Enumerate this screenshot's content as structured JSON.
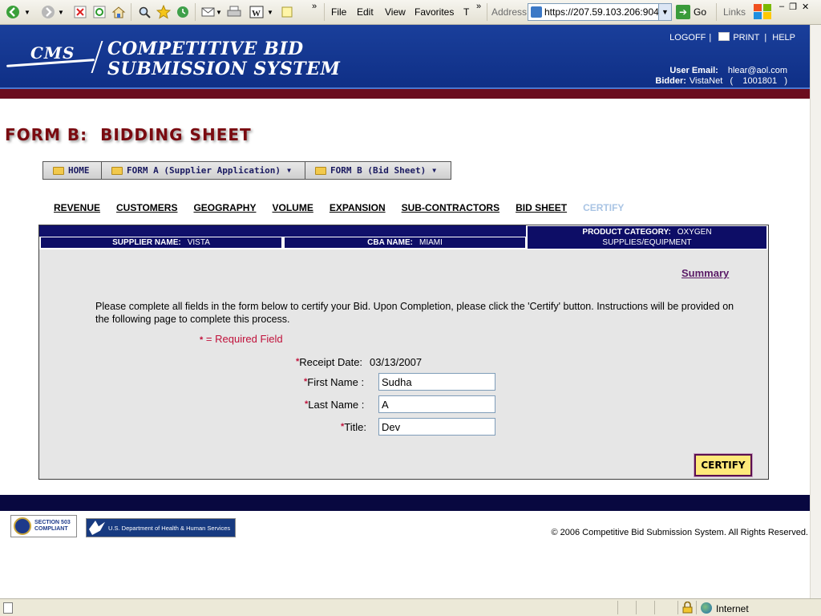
{
  "browser": {
    "menu": [
      "File",
      "Edit",
      "View",
      "Favorites",
      "T"
    ],
    "address_label": "Address",
    "address_url": "https://207.59.103.206:9049",
    "go_label": "Go",
    "links_label": "Links",
    "chevron": "»",
    "status_zone": "Internet"
  },
  "header": {
    "logo_text": "CMS",
    "title_line1": "COMPETITIVE BID",
    "title_line2": "SUBMISSION SYSTEM",
    "logoff": "LOGOFF",
    "print": "PRINT",
    "help": "HELP",
    "sep": "|",
    "user_email_label": "User Email:",
    "user_email": "hlear@aol.com",
    "bidder_label": "Bidder:",
    "bidder_value": "VistaNet   (    1001801   )"
  },
  "page": {
    "form_title": "FORM B:  BIDDING SHEET"
  },
  "nav": {
    "home": "HOME",
    "form_a": "FORM A (Supplier Application)",
    "form_b": "FORM B (Bid Sheet)"
  },
  "sub_tabs": {
    "revenue": "REVENUE",
    "customers": "CUSTOMERS",
    "geography": "GEOGRAPHY",
    "volume": "VOLUME",
    "expansion": "EXPANSION",
    "subcontractors": "SUB-CONTRACTORS",
    "bid_sheet": "BID SHEET",
    "certify": "CERTIFY"
  },
  "info": {
    "supplier_label": "SUPPLIER NAME:",
    "supplier_value": "VISTA",
    "cba_label": "CBA NAME:",
    "cba_value": "MIAMI",
    "category_label": "PRODUCT CATEGORY:",
    "category_value_1": "OXYGEN",
    "category_value_2": "SUPPLIES/EQUIPMENT"
  },
  "certify_form": {
    "summary_link": "Summary",
    "instructions": "Please complete all fields in the form below to certify your Bid. Upon Completion, please click the 'Certify' button. Instructions will be provided on the following page to complete this process.",
    "star": "*",
    "required_note": "= Required Field",
    "receipt_label": "Receipt Date:",
    "receipt_value": "03/13/2007",
    "first_name_label": "First Name :",
    "first_name_value": "Sudha",
    "last_name_label": "Last Name :",
    "last_name_value": "A",
    "title_label": "Title:",
    "title_value": "Dev",
    "certify_button": "CERTIFY"
  },
  "footer": {
    "sec508_line1": "SECTION 503",
    "sec508_line2": "COMPLIANT",
    "hhs_text": "U.S. Department of Health & Human Services",
    "copyright": "© 2006 Competitive Bid Submission System. All Rights Reserved."
  },
  "colors": {
    "header_blue": "#0f2f86",
    "maroon_bar": "#6b0c1e",
    "navy_cells": "#0d0d66",
    "title_red": "#7a0a10",
    "required_red": "#c0103a",
    "certify_yellow": "#ffe97a"
  }
}
